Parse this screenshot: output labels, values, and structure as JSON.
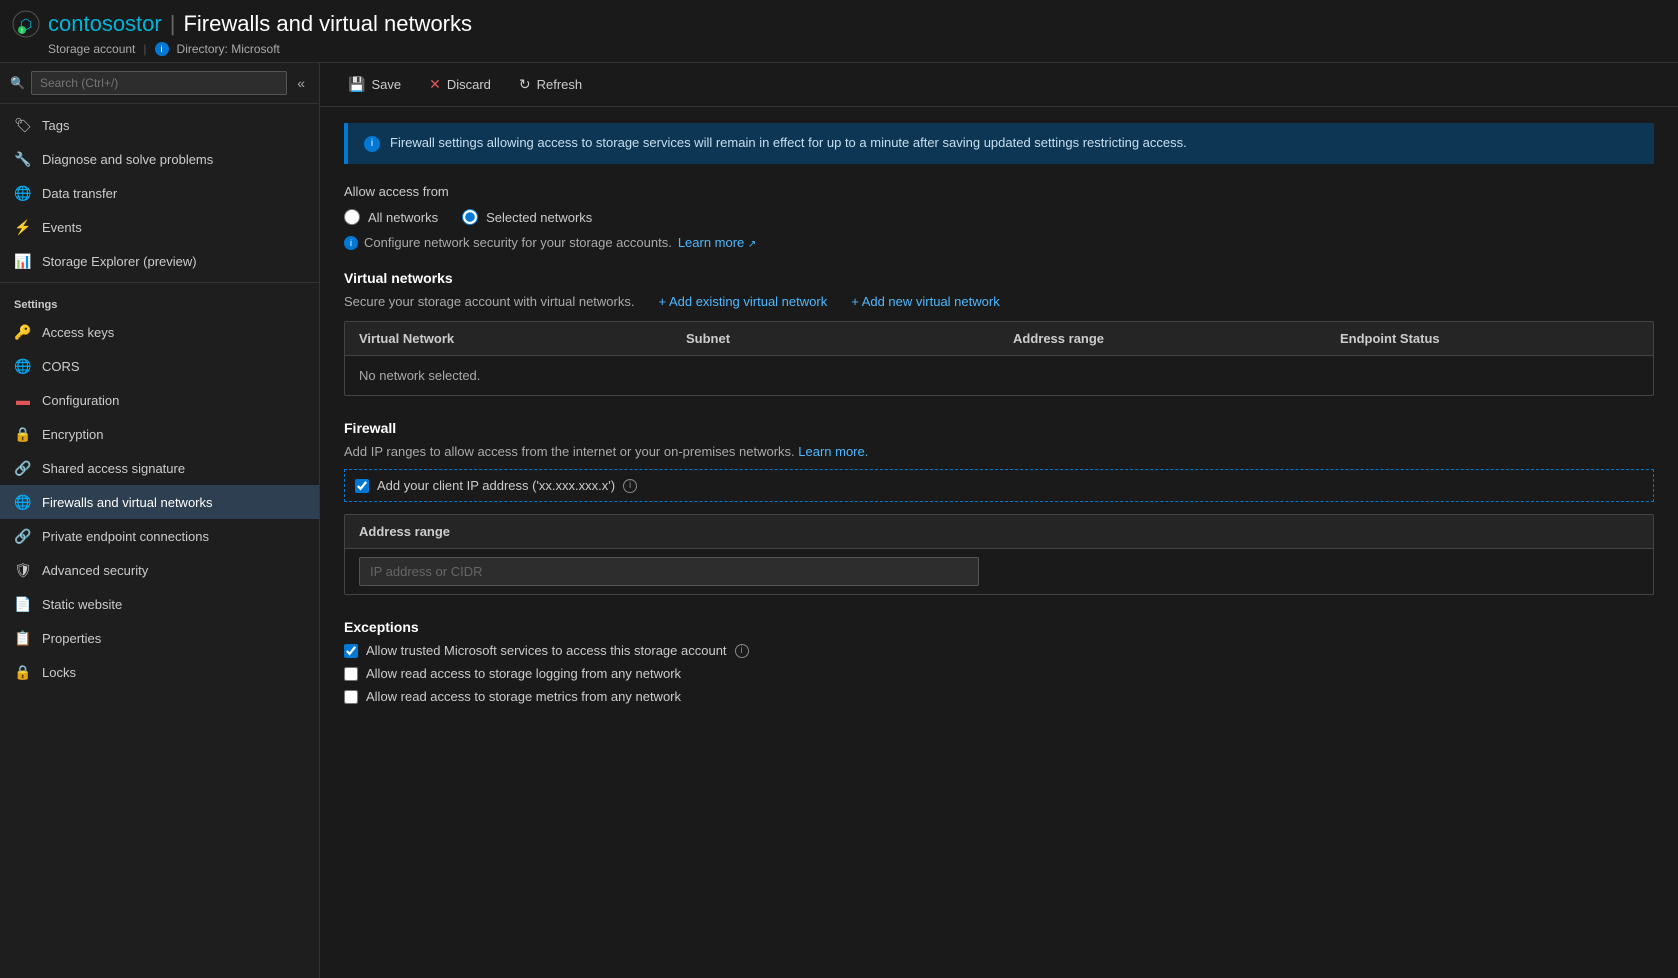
{
  "header": {
    "icon": "🔵",
    "account_name": "contosostor",
    "separator": "|",
    "page_title": "Firewalls and virtual networks",
    "breadcrumb_storage": "Storage account",
    "breadcrumb_dir_icon": "ℹ",
    "breadcrumb_dir": "Directory: Microsoft"
  },
  "toolbar": {
    "save_label": "Save",
    "discard_label": "Discard",
    "refresh_label": "Refresh"
  },
  "sidebar": {
    "search_placeholder": "Search (Ctrl+/)",
    "collapse_icon": "«",
    "nav_items_top": [
      {
        "id": "tags",
        "label": "Tags",
        "icon": "🏷"
      },
      {
        "id": "diagnose",
        "label": "Diagnose and solve problems",
        "icon": "🔧"
      },
      {
        "id": "datatransfer",
        "label": "Data transfer",
        "icon": "🌐"
      },
      {
        "id": "events",
        "label": "Events",
        "icon": "⚡"
      },
      {
        "id": "storage-explorer",
        "label": "Storage Explorer (preview)",
        "icon": "📊"
      }
    ],
    "settings_header": "Settings",
    "nav_items_settings": [
      {
        "id": "access-keys",
        "label": "Access keys",
        "icon": "🔑"
      },
      {
        "id": "cors",
        "label": "CORS",
        "icon": "🌐"
      },
      {
        "id": "configuration",
        "label": "Configuration",
        "icon": "🔴"
      },
      {
        "id": "encryption",
        "label": "Encryption",
        "icon": "🔒"
      },
      {
        "id": "shared-access",
        "label": "Shared access signature",
        "icon": "🔗"
      },
      {
        "id": "firewalls",
        "label": "Firewalls and virtual networks",
        "icon": "🌐",
        "active": true
      },
      {
        "id": "private-endpoint",
        "label": "Private endpoint connections",
        "icon": "🔗"
      },
      {
        "id": "advanced-security",
        "label": "Advanced security",
        "icon": "🛡"
      },
      {
        "id": "static-website",
        "label": "Static website",
        "icon": "📄"
      },
      {
        "id": "properties",
        "label": "Properties",
        "icon": "📋"
      },
      {
        "id": "locks",
        "label": "Locks",
        "icon": "🔒"
      }
    ]
  },
  "info_banner": {
    "text": "Firewall settings allowing access to storage services will remain in effect for up to a minute after saving updated settings restricting access."
  },
  "allow_access": {
    "label": "Allow access from",
    "options": [
      {
        "id": "all-networks",
        "label": "All networks",
        "checked": false
      },
      {
        "id": "selected-networks",
        "label": "Selected networks",
        "checked": true
      }
    ],
    "configure_text": "Configure network security for your storage accounts.",
    "learn_more": "Learn more",
    "learn_more_icon": "↗"
  },
  "virtual_networks": {
    "title": "Virtual networks",
    "description": "Secure your storage account with virtual networks.",
    "add_existing": "+ Add existing virtual network",
    "add_new": "+ Add new virtual network",
    "table_headers": [
      "Virtual Network",
      "Subnet",
      "Address range",
      "Endpoint Status"
    ],
    "no_data_text": "No network selected."
  },
  "firewall": {
    "title": "Firewall",
    "description": "Add IP ranges to allow access from the internet or your on-premises networks.",
    "learn_more": "Learn more.",
    "client_ip_label": "Add your client IP address ('xx.xxx.xxx.x')",
    "client_ip_checked": true,
    "table_headers": [
      "Address range",
      ""
    ],
    "ip_placeholder": "IP address or CIDR"
  },
  "exceptions": {
    "title": "Exceptions",
    "items": [
      {
        "id": "trusted-ms",
        "label": "Allow trusted Microsoft services to access this storage account",
        "checked": true,
        "info": true
      },
      {
        "id": "read-logging",
        "label": "Allow read access to storage logging from any network",
        "checked": false,
        "info": false
      },
      {
        "id": "read-metrics",
        "label": "Allow read access to storage metrics from any network",
        "checked": false,
        "info": false
      }
    ]
  }
}
